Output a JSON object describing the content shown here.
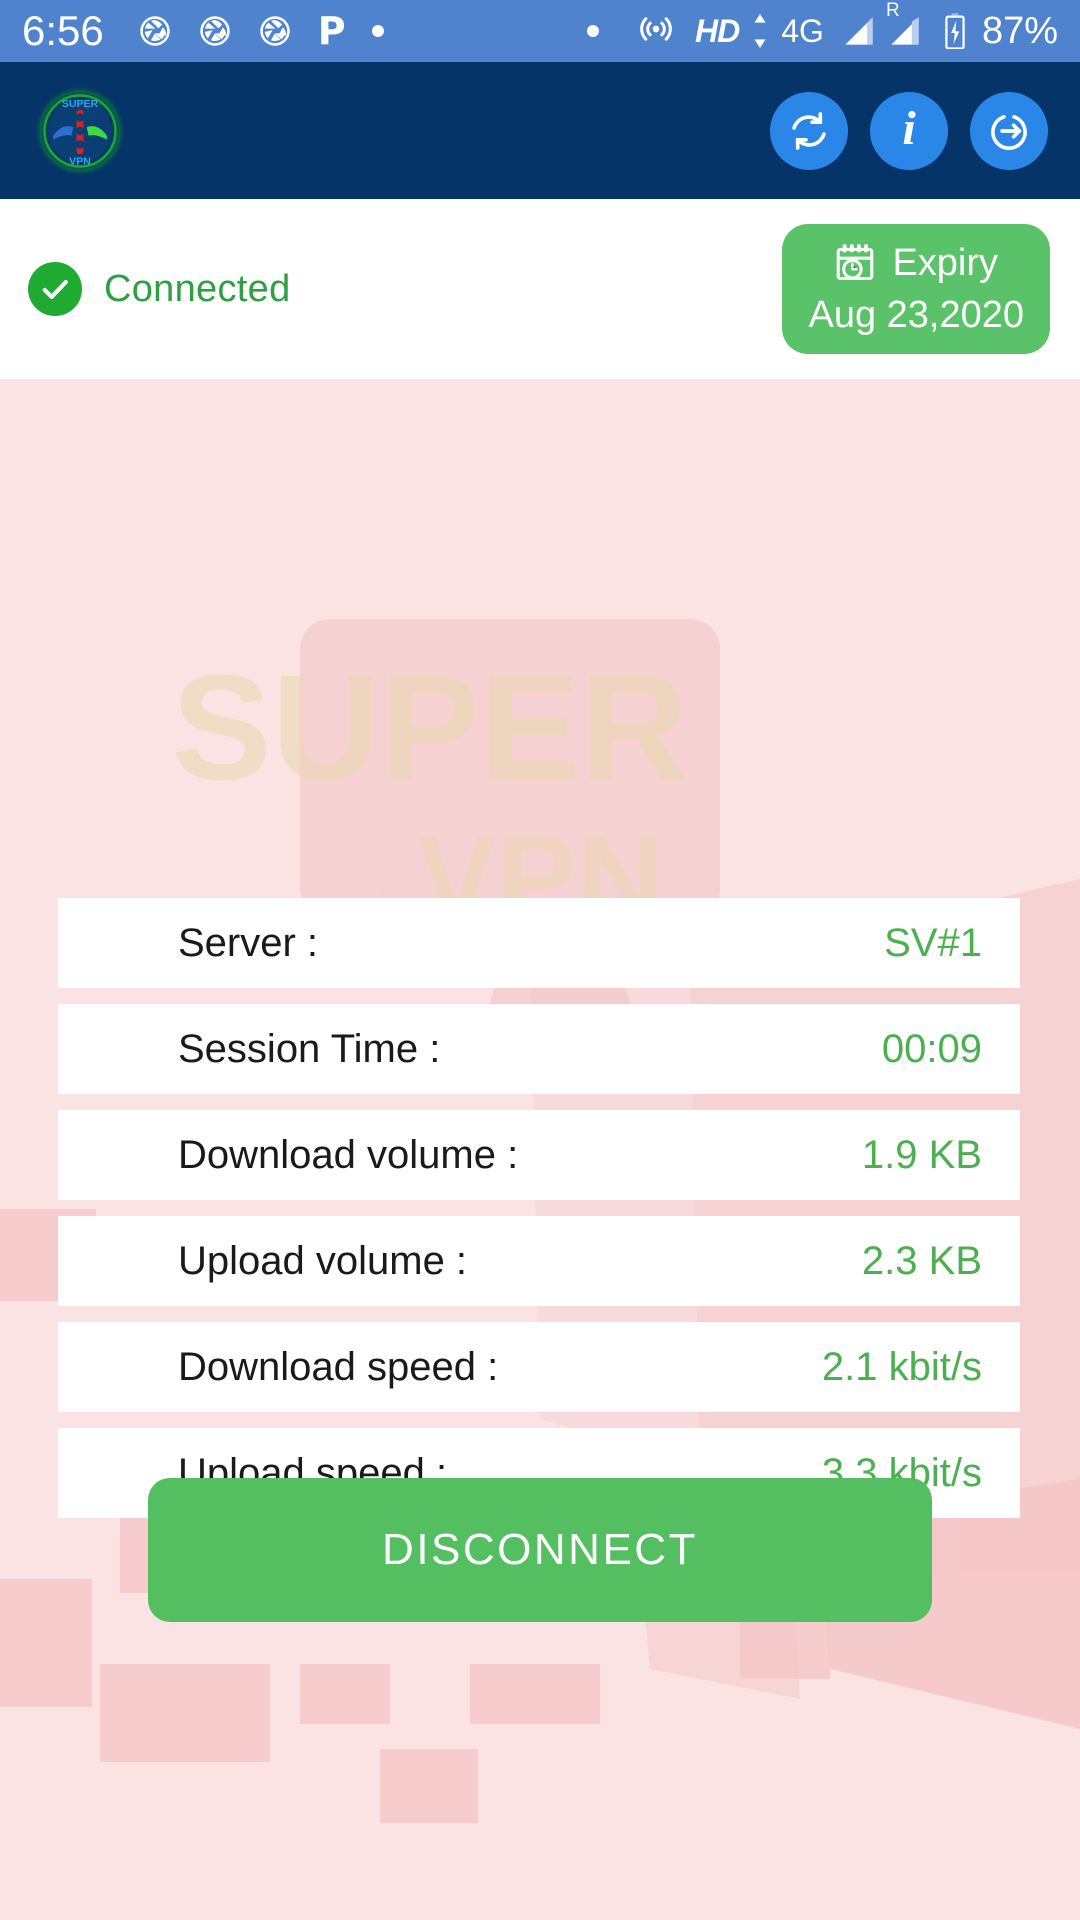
{
  "status_bar": {
    "time": "6:56",
    "left_icons": [
      "aperture-icon",
      "aperture-icon",
      "aperture-icon",
      "p-icon",
      "dot-icon"
    ],
    "right_icons": [
      "dot-icon",
      "hotspot-icon",
      "hd-icon",
      "data-arrows-icon",
      "network-4g",
      "signal-bars-icon",
      "roaming-icon",
      "signal-bars-icon",
      "battery-charging-icon"
    ],
    "hd_label": "HD",
    "network": "4G",
    "roaming": "R",
    "battery": "87%",
    "background_color": "#5083cd",
    "foreground_color": "#ffffff"
  },
  "app_bar": {
    "logo_name": "super-vpn-logo",
    "logo_text_top": "SUPER",
    "logo_text_bottom": "VPN",
    "background_color": "#043468",
    "actions": [
      {
        "name": "refresh-button",
        "icon": "refresh-icon"
      },
      {
        "name": "info-button",
        "icon": "info-icon",
        "glyph": "i"
      },
      {
        "name": "logout-button",
        "icon": "logout-arrow-icon"
      }
    ]
  },
  "status_strip": {
    "connection_status": "Connected",
    "status_icon": "check-circle-icon",
    "status_color": "#2f9e44",
    "expiry": {
      "icon": "calendar-clock-icon",
      "label": "Expiry",
      "date": "Aug 23,2020",
      "badge_color": "#5ac268"
    }
  },
  "stats": {
    "rows": [
      {
        "label": "Server :",
        "value": "SV#1"
      },
      {
        "label": "Session Time :",
        "value": "00:09"
      },
      {
        "label": "Download volume :",
        "value": "1.9 KB"
      },
      {
        "label": "Upload volume :",
        "value": "2.3 KB"
      },
      {
        "label": "Download speed :",
        "value": "2.1 kbit/s"
      },
      {
        "label": "Upload speed :",
        "value": "3.3 kbit/s"
      }
    ],
    "value_color": "#4caf50",
    "label_color": "#1a1a1a",
    "row_background": "#ffffff"
  },
  "primary_action": {
    "label": "DISCONNECT",
    "color": "#53bf60"
  },
  "theme": {
    "page_background": "#fbe3e3",
    "accent_green": "#53bf60",
    "header_navy": "#043468",
    "status_blue": "#5083cd"
  }
}
